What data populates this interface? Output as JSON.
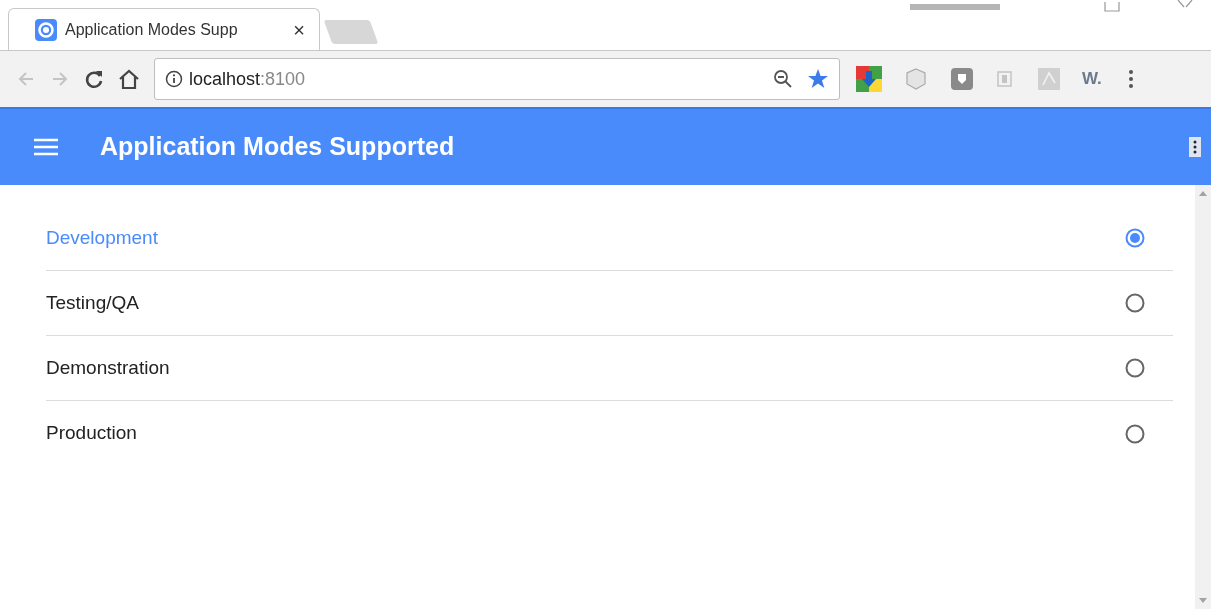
{
  "browser": {
    "tab_title": "Application Modes Supp",
    "tab_close": "×",
    "address_host": "localhost",
    "address_port": ":8100",
    "extension_label": "W."
  },
  "app_bar": {
    "title": "Application Modes Supported"
  },
  "modes": [
    {
      "label": "Development",
      "selected": true
    },
    {
      "label": "Testing/QA",
      "selected": false
    },
    {
      "label": "Demonstration",
      "selected": false
    },
    {
      "label": "Production",
      "selected": false
    }
  ]
}
